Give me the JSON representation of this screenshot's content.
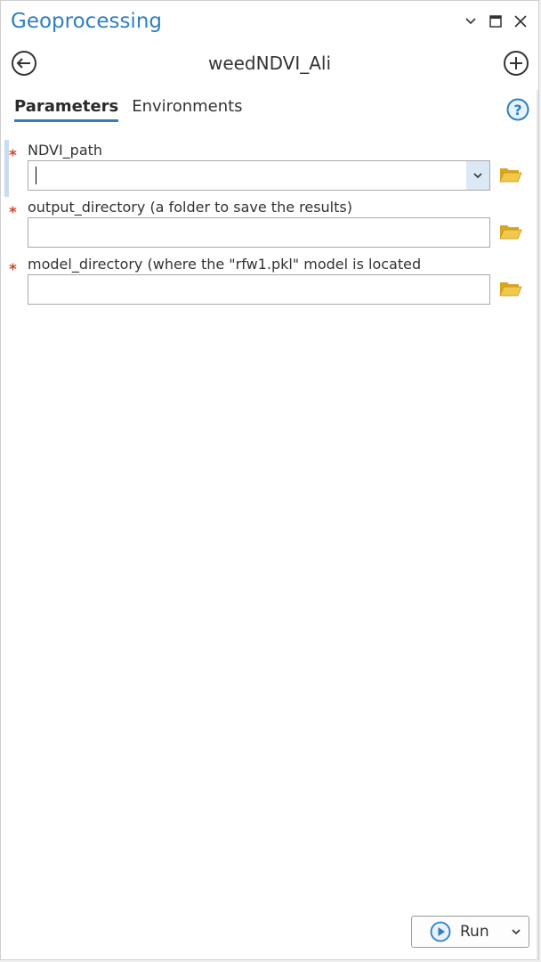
{
  "panel": {
    "title": "Geoprocessing",
    "tool_name": "weedNDVI_Ali"
  },
  "window_controls": {
    "menu_icon": "chevron-down-icon",
    "maximize_icon": "maximize-icon",
    "close_icon": "close-icon"
  },
  "nav": {
    "back_icon": "back-arrow-icon",
    "add_icon": "add-icon"
  },
  "tabs": [
    {
      "label": "Parameters",
      "active": true
    },
    {
      "label": "Environments",
      "active": false
    }
  ],
  "help_icon": "help-icon",
  "parameters": [
    {
      "label": "NDVI_path",
      "required": true,
      "value": "",
      "has_dropdown": true,
      "focused": true
    },
    {
      "label": "output_directory (a folder to save the results)",
      "required": true,
      "value": "",
      "has_dropdown": false
    },
    {
      "label": "model_directory (where the \"rfw1.pkl\" model is located",
      "required": true,
      "value": "",
      "has_dropdown": false
    }
  ],
  "required_marker": "*",
  "run": {
    "label": "Run",
    "icon": "play-icon"
  },
  "colors": {
    "accent_blue": "#2f7fc1",
    "required_red": "#d4452f",
    "folder_yellow": "#e5b634",
    "dropdown_bg": "#dbe9f7"
  }
}
